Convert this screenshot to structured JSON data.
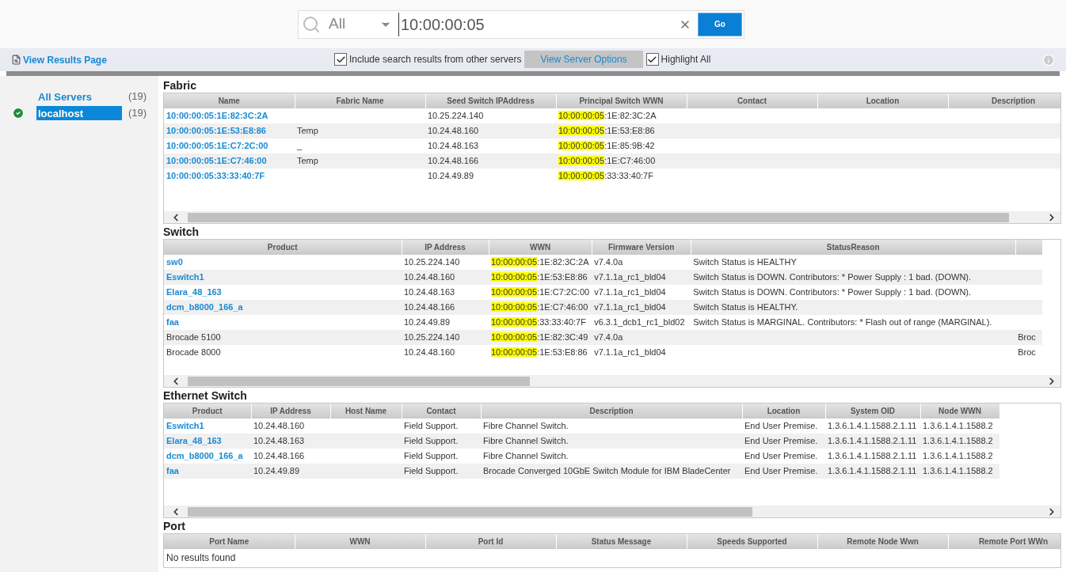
{
  "search": {
    "scope": "All",
    "value": "10:00:00:05",
    "go": "Go"
  },
  "toolbar": {
    "view_results": "View Results Page",
    "options": [
      {
        "label": "Include search results from other servers",
        "checked": true
      },
      {
        "label": "Highlight All",
        "checked": true
      }
    ],
    "server_options": "View Server Options"
  },
  "sidebar": {
    "items": [
      {
        "label": "All Servers",
        "count": "(19)",
        "selected": false,
        "healthy": false
      },
      {
        "label": "localhost",
        "count": "(19)",
        "selected": true,
        "healthy": true
      }
    ]
  },
  "sections": [
    {
      "title": "Fabric",
      "columns": [
        "Name",
        "Fabric Name",
        "Seed Switch IPAddress",
        "Principal Switch WWN",
        "Contact",
        "Location",
        "Description"
      ],
      "rows": [
        {
          "linked": true,
          "cells": [
            "10:00:00:05:1E:82:3C:2A",
            "",
            "10.25.224.140",
            {
              "match": "10:00:00:05",
              "rest": ":1E:82:3C:2A"
            },
            "",
            "",
            ""
          ]
        },
        {
          "linked": true,
          "cells": [
            "10:00:00:05:1E:53:E8:86",
            "Temp",
            "10.24.48.160",
            {
              "match": "10:00:00:05",
              "rest": ":1E:53:E8:86"
            },
            "",
            "",
            ""
          ]
        },
        {
          "linked": true,
          "cells": [
            "10:00:00:05:1E:C7:2C:00",
            "_",
            "10.24.48.163",
            {
              "match": "10:00:00:05",
              "rest": ":1E:85:9B:42"
            },
            "",
            "",
            ""
          ]
        },
        {
          "linked": true,
          "cells": [
            "10:00:00:05:1E:C7:46:00",
            "Temp",
            "10.24.48.166",
            {
              "match": "10:00:00:05",
              "rest": ":1E:C7:46:00"
            },
            "",
            "",
            ""
          ]
        },
        {
          "linked": true,
          "cells": [
            "10:00:00:05:33:33:40:7F",
            "",
            "10.24.49.89",
            {
              "match": "10:00:00:05",
              "rest": ":33:33:40:7F"
            },
            "",
            "",
            ""
          ]
        }
      ]
    },
    {
      "title": "Switch",
      "columns": [
        "Product",
        "IP Address",
        "WWN",
        "Firmware Version",
        "StatusReason",
        ""
      ],
      "rows": [
        {
          "linked": true,
          "cells": [
            "sw0",
            "10.25.224.140",
            {
              "match": "10:00:00:05",
              "rest": ":1E:82:3C:2A"
            },
            "v7.4.0a",
            "Switch Status is HEALTHY",
            ""
          ]
        },
        {
          "linked": true,
          "cells": [
            "Eswitch1",
            "10.24.48.160",
            {
              "match": "10:00:00:05",
              "rest": ":1E:53:E8:86"
            },
            "v7.1.1a_rc1_bld04",
            "Switch Status is DOWN. Contributors: * Power Supply : 1 bad. (DOWN).",
            ""
          ]
        },
        {
          "linked": true,
          "cells": [
            "Elara_48_163",
            "10.24.48.163",
            {
              "match": "10:00:00:05",
              "rest": ":1E:C7:2C:00"
            },
            "v7.1.1a_rc1_bld04",
            "Switch Status is DOWN. Contributors: * Power Supply : 1 bad. (DOWN).",
            ""
          ]
        },
        {
          "linked": true,
          "cells": [
            "dcm_b8000_166_a",
            "10.24.48.166",
            {
              "match": "10:00:00:05",
              "rest": ":1E:C7:46:00"
            },
            "v7.1.1a_rc1_bld04",
            "Switch Status is HEALTHY.",
            ""
          ]
        },
        {
          "linked": true,
          "cells": [
            "faa",
            "10.24.49.89",
            {
              "match": "10:00:00:05",
              "rest": ":33:33:40:7F"
            },
            "v6.3.1_dcb1_rc1_bld02",
            "Switch Status is MARGINAL. Contributors: * Flash out of range (MARGINAL).",
            ""
          ]
        },
        {
          "linked": false,
          "cells": [
            "Brocade 5100",
            "10.25.224.140",
            {
              "match": "10:00:00:05",
              "rest": ":1E:82:3C:49"
            },
            "v7.4.0a",
            "",
            "Broc"
          ]
        },
        {
          "linked": false,
          "cells": [
            "Brocade 8000",
            "10.24.48.160",
            {
              "match": "10:00:00:05",
              "rest": ":1E:53:E8:86"
            },
            "v7.1.1a_rc1_bld04",
            "",
            "Broc"
          ]
        }
      ]
    },
    {
      "title": "Ethernet Switch",
      "columns": [
        "Product",
        "IP Address",
        "Host Name",
        "Contact",
        "Description",
        "Location",
        "System OID",
        "Node WWN"
      ],
      "rows": [
        {
          "linked": true,
          "cells": [
            "Eswitch1",
            "10.24.48.160",
            "",
            "Field Support.",
            "Fibre Channel Switch.",
            "End User Premise.",
            "1.3.6.1.4.1.1588.2.1.11",
            "1.3.6.1.4.1.1588.2"
          ]
        },
        {
          "linked": true,
          "cells": [
            "Elara_48_163",
            "10.24.48.163",
            "",
            "Field Support.",
            "Fibre Channel Switch.",
            "End User Premise.",
            "1.3.6.1.4.1.1588.2.1.11",
            "1.3.6.1.4.1.1588.2"
          ]
        },
        {
          "linked": true,
          "cells": [
            "dcm_b8000_166_a",
            "10.24.48.166",
            "",
            "Field Support.",
            "Fibre Channel Switch.",
            "End User Premise.",
            "1.3.6.1.4.1.1588.2.1.11",
            "1.3.6.1.4.1.1588.2"
          ]
        },
        {
          "linked": true,
          "cells": [
            "faa",
            "10.24.49.89",
            "",
            "Field Support.",
            "Brocade Converged 10GbE Switch Module for IBM BladeCenter",
            "End User Premise.",
            "1.3.6.1.4.1.1588.2.1.11",
            "1.3.6.1.4.1.1588.2"
          ]
        }
      ]
    },
    {
      "title": "Port",
      "columns": [
        "Port Name",
        "WWN",
        "Port Id",
        "Status Message",
        "Speeds Supported",
        "Remote Node Wwn",
        "Remote Port WWn"
      ],
      "empty": "No results found"
    }
  ]
}
